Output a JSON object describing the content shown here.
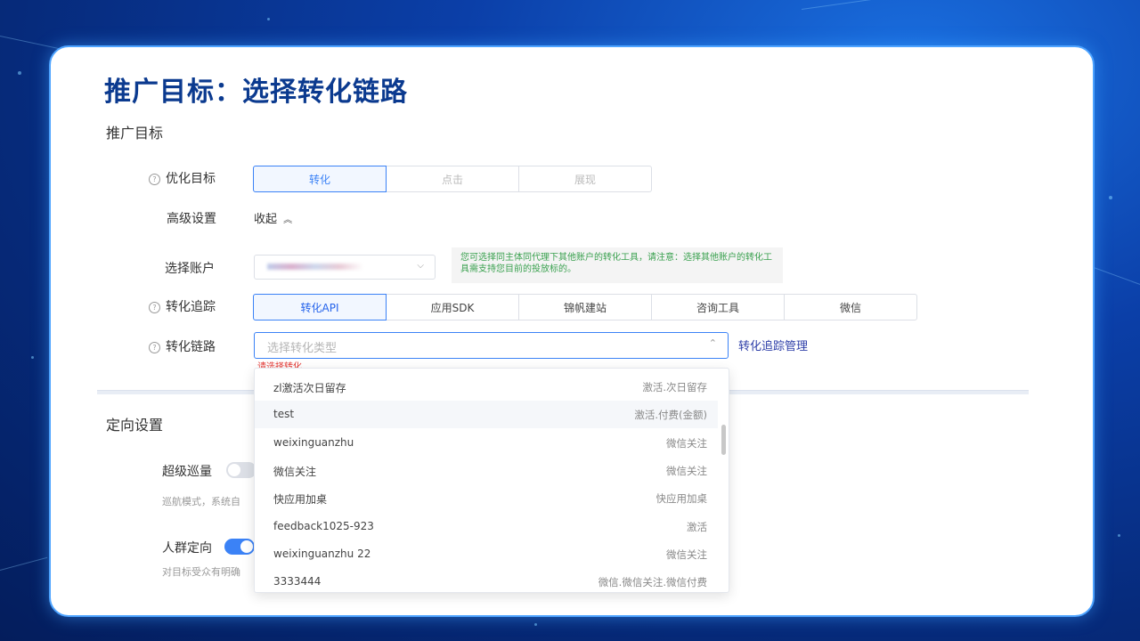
{
  "title": "推广目标：选择转化链路",
  "section_goal": "推广目标",
  "optimize": {
    "label": "优化目标",
    "options": [
      "转化",
      "点击",
      "展现"
    ],
    "selected": "转化"
  },
  "advanced": {
    "label": "高级设置",
    "collapse": "收起"
  },
  "account": {
    "label": "选择账户",
    "tip": "您可选择同主体同代理下其他账户的转化工具，请注意：选择其他账户的转化工具需支持您目前的投放标的。"
  },
  "tracking": {
    "label": "转化追踪",
    "options": [
      "转化API",
      "应用SDK",
      "锦帆建站",
      "咨询工具",
      "微信"
    ],
    "selected": "转化API"
  },
  "chain": {
    "label": "转化链路",
    "placeholder": "选择转化类型",
    "manage_link": "转化追踪管理",
    "error": "请选择转化"
  },
  "section_targeting": "定向设置",
  "cruise": {
    "label": "超级巡量",
    "desc": "巡航模式，系统自"
  },
  "crowd": {
    "label": "人群定向",
    "desc": "对目标受众有明确"
  },
  "dropdown": {
    "options": [
      {
        "name": "zl激活次日留存",
        "type": "激活.次日留存"
      },
      {
        "name": "test",
        "type": "激活.付费(金额)"
      },
      {
        "name": "weixinguanzhu",
        "type": "微信关注"
      },
      {
        "name": "微信关注",
        "type": "微信关注"
      },
      {
        "name": "快应用加桌",
        "type": "快应用加桌"
      },
      {
        "name": "feedback1025-923",
        "type": "激活"
      },
      {
        "name": "weixinguanzhu 22",
        "type": "微信关注"
      },
      {
        "name": "3333444",
        "type": "微信.微信关注.微信付费"
      }
    ],
    "highlighted_index": 1
  },
  "colors": {
    "accent": "#3b82f6",
    "title": "#0b3a8f",
    "tip_text": "#3aa14f",
    "error": "#e53935"
  }
}
